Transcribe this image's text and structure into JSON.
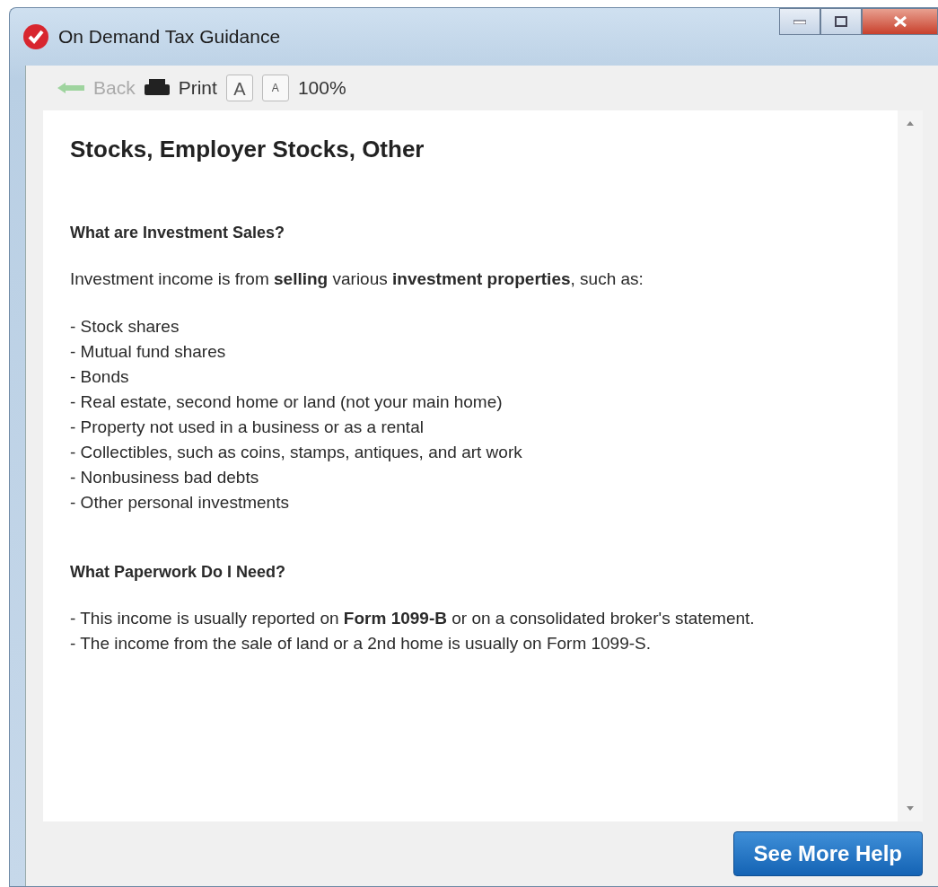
{
  "window": {
    "title": "On Demand Tax Guidance"
  },
  "toolbar": {
    "back": {
      "label": "Back",
      "disabled": true
    },
    "print": {
      "label": "Print"
    },
    "font_buttons": [
      {
        "label": "A",
        "kind": "larger"
      },
      {
        "label": "A",
        "kind": "smaller"
      }
    ],
    "zoom": "100%"
  },
  "article": {
    "title": "Stocks, Employer Stocks, Other",
    "sections": [
      {
        "heading": "What are Investment Sales?",
        "intro": "Investment income is from **selling** various **investment properties**, such as:",
        "lines": [
          "- Stock shares",
          "- Mutual fund shares",
          "- Bonds",
          "- Real estate, second home or land (not your main home)",
          "- Property not used in a business or as a rental",
          "- Collectibles, such as coins, stamps, antiques, and art work",
          "- Nonbusiness bad debts",
          "- Other personal investments"
        ]
      },
      {
        "heading": "What Paperwork Do I Need?",
        "lines": [
          "- This income is usually reported on **Form 1099-B** or on a consolidated broker's statement.",
          "- The income from the sale of land or a 2nd home is usually on Form 1099-S."
        ]
      }
    ]
  },
  "footer": {
    "button": "See More Help"
  }
}
